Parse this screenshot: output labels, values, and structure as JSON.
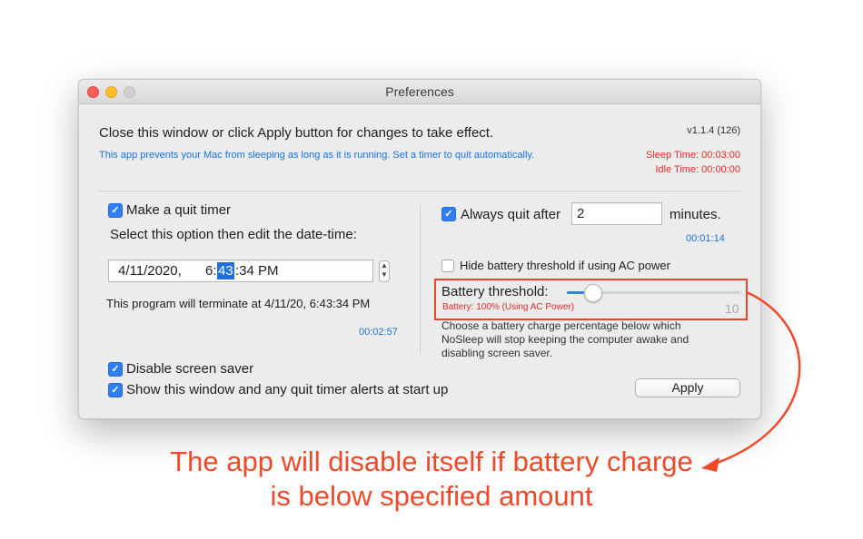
{
  "window": {
    "title": "Preferences",
    "header_text": "Close this window or click Apply button for changes to take effect.",
    "version": "v1.1.4 (126)",
    "description": "This app prevents your Mac from sleeping as long as it is running. Set a timer to quit automatically.",
    "sleep_time": "Sleep Time: 00:03:00",
    "idle_time": "Idle Time: 00:00:00"
  },
  "left": {
    "quit_timer_label": "Make a quit timer",
    "quit_timer_checked": true,
    "select_hint": "Select this option then edit the date-time:",
    "date_part": "4/11/2020,",
    "time_hour": "6:",
    "time_minute": "43",
    "time_rest": ":34 PM",
    "terminate_text": "This program will terminate at 4/11/20, 6:43:34 PM",
    "countdown": "00:02:57",
    "disable_screensaver_label": "Disable screen saver",
    "disable_screensaver_checked": true,
    "show_window_label": "Show this window and any quit timer alerts at start up",
    "show_window_checked": true
  },
  "right": {
    "always_quit_label": "Always quit after",
    "always_quit_checked": true,
    "minutes_value": "2",
    "minutes_unit": "minutes.",
    "always_quit_countdown": "00:01:14",
    "hide_battery_label": "Hide battery threshold if using AC power",
    "hide_battery_checked": false,
    "battery_threshold_label": "Battery threshold:",
    "battery_threshold_value": "10",
    "battery_slider_fraction": 0.1,
    "battery_status": "Battery: 100% (Using AC Power)",
    "battery_help": "Choose a battery charge percentage below which NoSleep will stop keeping the computer awake and disabling screen saver.",
    "apply_label": "Apply"
  },
  "annotation": {
    "caption_line1": "The app will disable itself if battery charge",
    "caption_line2": "is below specified amount",
    "color": "#ee4a2a"
  },
  "icons": {
    "checkmark": "checkmark-icon",
    "stepper": "stepper-icon",
    "arrow": "annotation-arrow-icon"
  }
}
